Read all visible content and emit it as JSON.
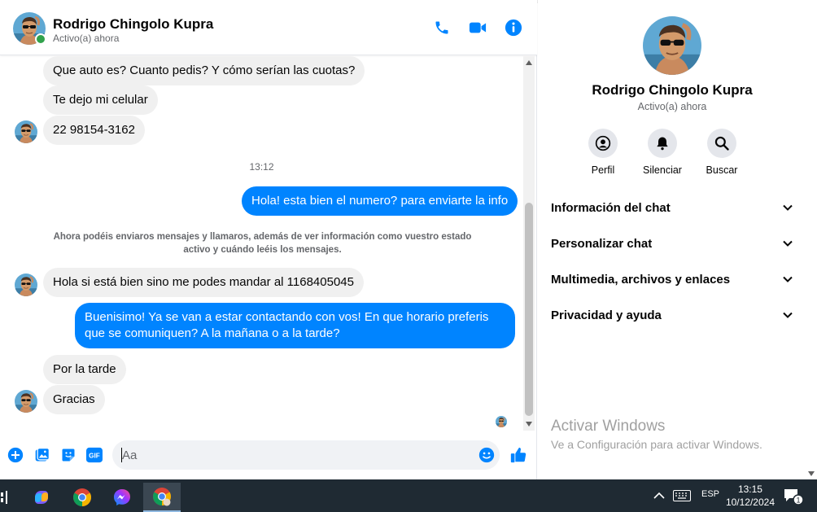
{
  "header": {
    "name": "Rodrigo Chingolo Kupra",
    "status": "Activo(a) ahora"
  },
  "messages": {
    "m1": "Que auto es? Cuanto pedis? Y cómo serían las cuotas?",
    "m2": "Te dejo mi celular",
    "m3": "22 98154-3162",
    "time": "13:12",
    "m4": "Hola! esta bien el numero? para enviarte la info",
    "notice": "Ahora podéis enviaros mensajes y llamaros, además de ver información como vuestro estado activo y cuándo leéis los mensajes.",
    "m5": "Hola si está bien sino me podes mandar al 1168405045",
    "m6": "Buenisimo! Ya se van a estar contactando con vos! En que horario preferis que se comuniquen? A la mañana o a la tarde?",
    "m7": "Por la tarde",
    "m8": "Gracias"
  },
  "composer": {
    "placeholder": "Aa",
    "gif_label": "GIF"
  },
  "info": {
    "name": "Rodrigo Chingolo Kupra",
    "status": "Activo(a) ahora",
    "actions": [
      "Perfil",
      "Silenciar",
      "Buscar"
    ],
    "sections": [
      "Información del chat",
      "Personalizar chat",
      "Multimedia, archivos y enlaces",
      "Privacidad y ayuda"
    ]
  },
  "watermark": {
    "title": "Activar Windows",
    "subtitle": "Ve a Configuración para activar Windows."
  },
  "taskbar": {
    "lang": "ESP",
    "time": "13:15",
    "date": "10/12/2024",
    "notif_count": "1"
  },
  "colors": {
    "accent": "#0084ff",
    "incoming_bubble": "#f0f0f0",
    "online": "#31a24c",
    "taskbar": "#1f2a33"
  }
}
